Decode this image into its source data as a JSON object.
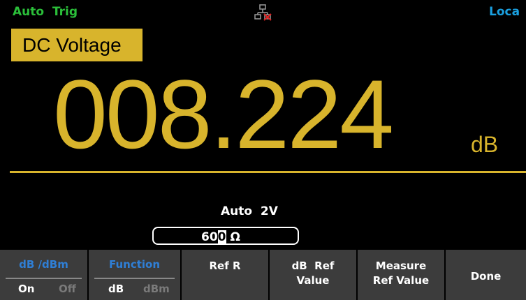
{
  "status": {
    "trigger_mode": "Auto  Trig",
    "network_icon": "network-disconnected-icon",
    "remote": "Loca"
  },
  "function": {
    "label": "DC Voltage"
  },
  "reading": {
    "value": "008.224",
    "unit": "dB"
  },
  "range": {
    "label": "Auto  2V"
  },
  "ref_field": {
    "value_prefix": "60",
    "cursor_digit": "0",
    "unit": "Ω"
  },
  "softkeys": {
    "db_dbm": {
      "title": "dB /dBm",
      "opt_on": "On",
      "opt_off": "Off"
    },
    "function": {
      "title": "Function",
      "opt_on": "dB",
      "opt_off": "dBm"
    },
    "ref_r": {
      "label": "Ref R"
    },
    "db_ref_value": {
      "line1": "dB  Ref",
      "line2": "Value"
    },
    "measure_ref": {
      "line1": "Measure",
      "line2": "Ref Value"
    },
    "done": {
      "label": "Done"
    }
  },
  "colors": {
    "accent_yellow": "#d8b42c",
    "status_green": "#2bbf3a",
    "remote_blue": "#1aa0e0",
    "softkey_bg": "#3c3c3c"
  }
}
